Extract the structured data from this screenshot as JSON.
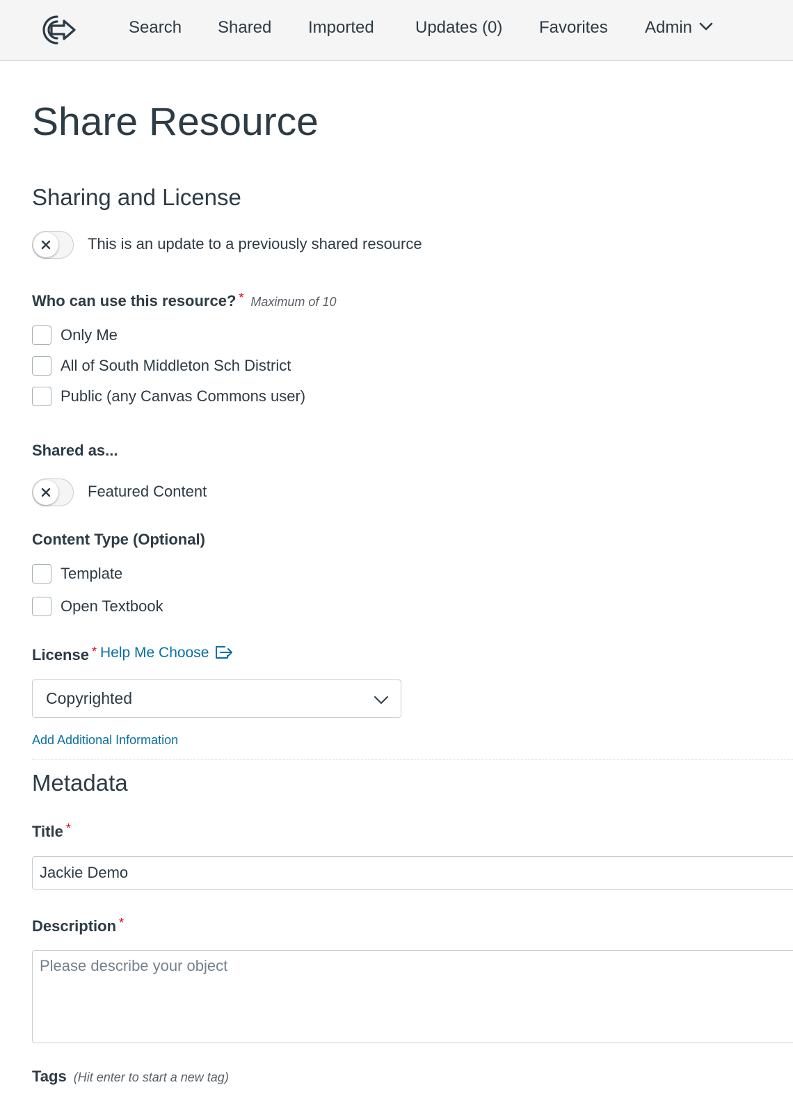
{
  "nav": {
    "items": [
      {
        "label": "Search"
      },
      {
        "label": "Shared"
      },
      {
        "label": "Imported"
      },
      {
        "label": "Updates (0)"
      },
      {
        "label": "Favorites"
      },
      {
        "label": "Admin"
      }
    ]
  },
  "page": {
    "title": "Share Resource"
  },
  "sharing": {
    "heading": "Sharing and License",
    "update_toggle_label": "This is an update to a previously shared resource",
    "who_label": "Who can use this resource?",
    "required_mark": "*",
    "who_hint": "Maximum of 10",
    "who_options": [
      {
        "label": "Only Me"
      },
      {
        "label": "All of South Middleton Sch District"
      },
      {
        "label": "Public (any Canvas Commons user)"
      }
    ],
    "shared_as_label": "Shared as...",
    "featured_label": "Featured Content",
    "content_type_label": "Content Type (Optional)",
    "content_types": [
      {
        "label": "Template"
      },
      {
        "label": "Open Textbook"
      }
    ],
    "license_label": "License",
    "help_link": "Help Me Choose",
    "license_value": "Copyrighted",
    "add_info_link": "Add Additional Information"
  },
  "metadata": {
    "heading": "Metadata",
    "title_label": "Title",
    "title_value": "Jackie Demo",
    "description_label": "Description",
    "description_placeholder": "Please describe your object",
    "tags_label": "Tags",
    "tags_hint": "(Hit enter to start a new tag)"
  },
  "colors": {
    "text": "#2d3b45",
    "link": "#0770a3",
    "required": "#e0061f",
    "nav_bg": "#f5f5f5",
    "border": "#c7cdd1"
  }
}
